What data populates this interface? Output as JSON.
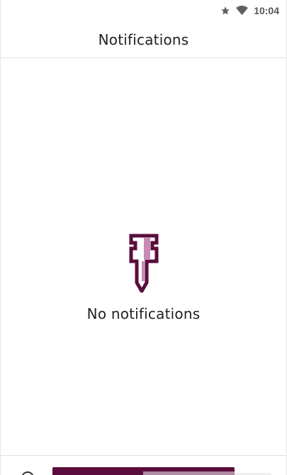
{
  "status_bar": {
    "time": "10:04",
    "icons": [
      "star-icon",
      "wifi-icon"
    ],
    "icon_color": "#5f5f5f"
  },
  "app_bar": {
    "title": "Notifications"
  },
  "empty_state": {
    "icon": "pushpin-icon",
    "message": "No notifications",
    "icon_color_dark": "#5a0d3c",
    "icon_color_light": "#c78bb4"
  },
  "bottom": {
    "snackbar_color": "#5a0d3c"
  }
}
